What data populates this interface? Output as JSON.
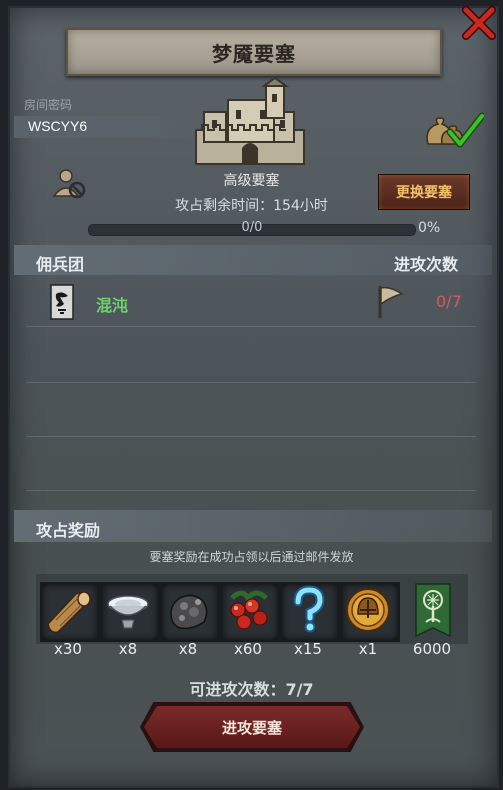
{
  "title": "梦魇要塞",
  "room": {
    "label": "房间密码",
    "code": "WSCYY6"
  },
  "fortress": {
    "type": "高级要塞",
    "time_label": "攻占剩余时间：154小时"
  },
  "change_button": "更换要塞",
  "progress": {
    "count": "0/0",
    "percent": "0%",
    "fraction": 0
  },
  "mercenary_section": {
    "left_header": "佣兵团",
    "right_header": "进攻次数",
    "rows": [
      {
        "name": "混沌",
        "attacks": "0/7"
      }
    ]
  },
  "reward_section": {
    "title": "攻占奖励",
    "note": "要塞奖励在成功占领以后通过邮件发放",
    "items": [
      {
        "icon": "wood-log-icon",
        "qty": "x30"
      },
      {
        "icon": "bowl-icon",
        "qty": "x8"
      },
      {
        "icon": "ore-icon",
        "qty": "x8"
      },
      {
        "icon": "berries-icon",
        "qty": "x60"
      },
      {
        "icon": "question-mark-icon",
        "qty": "x15"
      },
      {
        "icon": "helmet-coin-icon",
        "qty": "x1"
      },
      {
        "icon": "tree-banner-icon",
        "qty": "6000"
      }
    ]
  },
  "attacks_remaining": "可进攻次数：7/7",
  "attack_button": "进攻要塞",
  "colors": {
    "merc_name": "#6ed16a",
    "attack_count": "#d85a5a",
    "change_button_text": "#f4c06a"
  }
}
